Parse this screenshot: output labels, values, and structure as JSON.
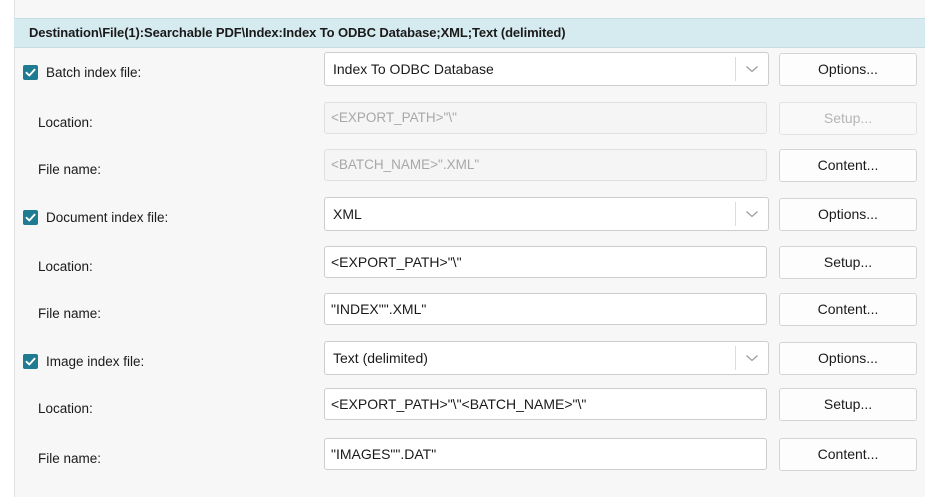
{
  "header": {
    "title": "Destination\\File(1):Searchable PDF\\Index:Index To ODBC Database;XML;Text (delimited)"
  },
  "sections": [
    {
      "checkbox_label": "Batch index file:",
      "checked": true,
      "type_value": "Index To ODBC Database",
      "options_label": "Options...",
      "location_label": "Location:",
      "location_value": "<EXPORT_PATH>\"\\\"",
      "location_enabled": false,
      "setup_label": "Setup...",
      "filename_label": "File name:",
      "filename_value": "<BATCH_NAME>\".XML\"",
      "filename_enabled": false,
      "content_label": "Content..."
    },
    {
      "checkbox_label": "Document index file:",
      "checked": true,
      "type_value": "XML",
      "options_label": "Options...",
      "location_label": "Location:",
      "location_value": "<EXPORT_PATH>\"\\\"",
      "location_enabled": true,
      "setup_label": "Setup...",
      "filename_label": "File name:",
      "filename_value": "\"INDEX\"\".XML\"",
      "filename_enabled": true,
      "content_label": "Content..."
    },
    {
      "checkbox_label": "Image index file:",
      "checked": true,
      "type_value": "Text (delimited)",
      "options_label": "Options...",
      "location_label": "Location:",
      "location_value": "<EXPORT_PATH>\"\\\"<BATCH_NAME>\"\\\"",
      "location_enabled": true,
      "setup_label": "Setup...",
      "filename_label": "File name:",
      "filename_value": "\"IMAGES\"\".DAT\"",
      "filename_enabled": true,
      "content_label": "Content..."
    }
  ],
  "icons": {
    "checkbox": "checkmark-icon",
    "dropdown": "chevron-down-icon"
  },
  "colors": {
    "header_bg": "#d6ebef",
    "checkbox_accent": "#1e7b91",
    "disabled_text": "#a8a8a8"
  }
}
